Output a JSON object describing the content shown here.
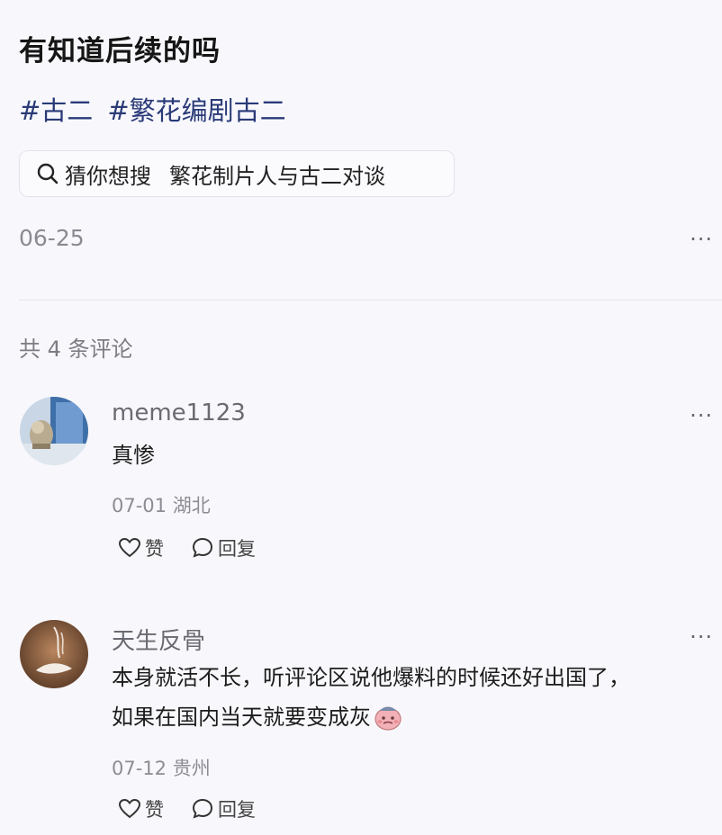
{
  "post": {
    "title": "有知道后续的吗",
    "tags": [
      "#古二",
      "#繁花编剧古二"
    ],
    "search": {
      "prefix": "猜你想搜",
      "query": "繁花制片人与古二对谈"
    },
    "date": "06-25",
    "more": "···"
  },
  "comments_header": "共 4 条评论",
  "comments": [
    {
      "user": "meme1123",
      "text": [
        "真惨"
      ],
      "date": "07-01",
      "location": "湖北",
      "like": "赞",
      "reply": "回复",
      "more": "···"
    },
    {
      "user": "天生反骨",
      "text": [
        "本身就活不长，听评论区说他爆料的时候还好出国了，",
        "如果在国内当天就要变成灰"
      ],
      "date": "07-12",
      "location": "贵州",
      "like": "赞",
      "reply": "回复",
      "more": "···"
    }
  ],
  "icons": [
    "search-icon",
    "heart-icon",
    "comment-icon",
    "more-icon",
    "emoji-icon"
  ],
  "colors": {
    "tag": "#2a3a78",
    "muted": "#8a8a92",
    "background": "#f8f8fc"
  }
}
